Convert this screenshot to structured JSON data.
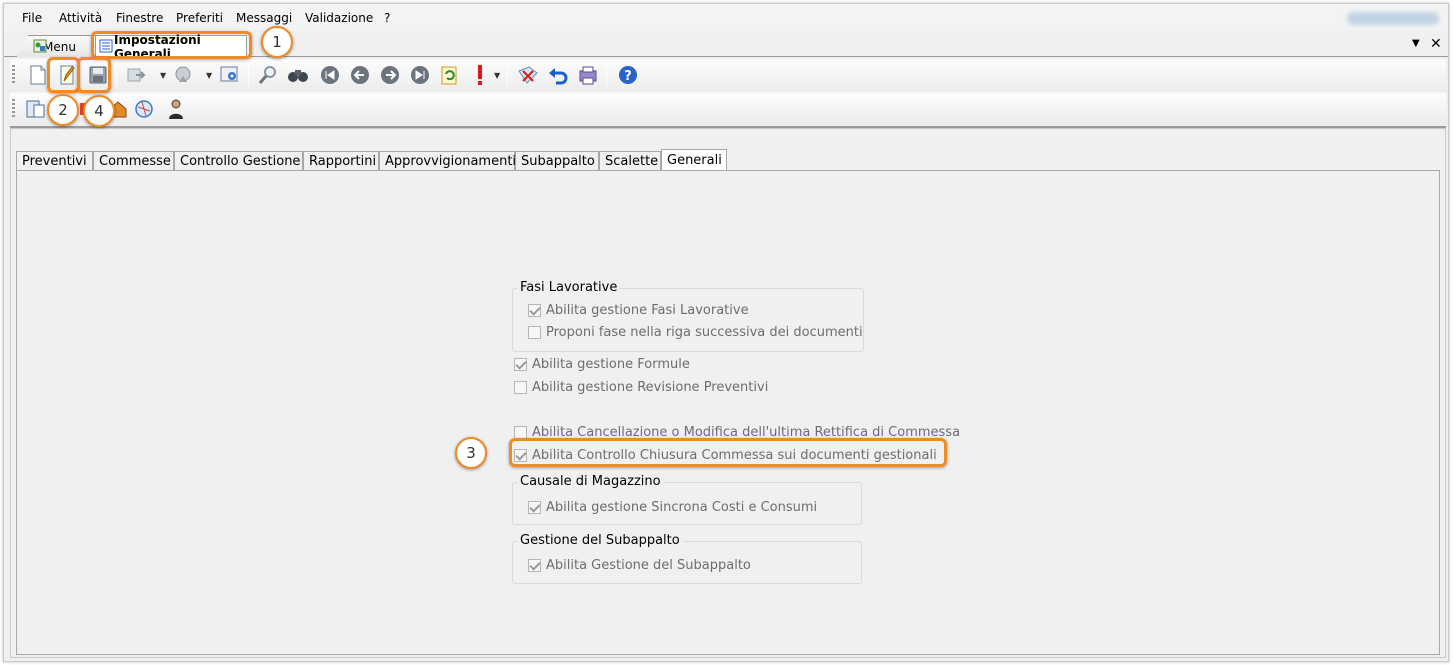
{
  "menubar": {
    "items": [
      "File",
      "Attività",
      "Finestre",
      "Preferiti",
      "Messaggi",
      "Validazione",
      "?"
    ]
  },
  "doc_tabs": {
    "menu_label": "Menu",
    "impostazioni_label": "Impostazioni Generali",
    "dropdown_glyph": "▼",
    "close_glyph": "✕"
  },
  "toolbar1": {
    "buttons": [
      "new-document-icon",
      "edit-icon",
      "save-icon",
      "export-icon",
      "satellite-icon",
      "settings-icon",
      "search-icon",
      "binoculars-icon",
      "first-record-icon",
      "previous-record-icon",
      "next-record-icon",
      "last-record-icon",
      "refresh-icon",
      "alert-icon",
      "cancel-icon",
      "undo-icon",
      "print-icon",
      "help-icon"
    ]
  },
  "toolbar2": {
    "buttons": [
      "clipboard-icon",
      "attachment-icon",
      "home-icon",
      "globe-icon",
      "user-icon"
    ]
  },
  "page_tabs": [
    "Preventivi",
    "Commesse",
    "Controllo Gestione",
    "Rapportini",
    "Approvvigionamenti",
    "Subappalto",
    "Scalette",
    "Generali"
  ],
  "form": {
    "fasi_group": {
      "title": "Fasi Lavorative",
      "abilita_fasi": {
        "label": "Abilita gestione Fasi Lavorative",
        "checked": true
      },
      "proponi_fase": {
        "label": "Proponi fase nella riga successiva dei documenti",
        "checked": false
      }
    },
    "formule": {
      "label": "Abilita gestione Formule",
      "checked": true
    },
    "revisione": {
      "label": "Abilita gestione Revisione Preventivi",
      "checked": false
    },
    "cancellazione": {
      "label": "Abilita Cancellazione o Modifica dell'ultima Rettifica di Commessa",
      "checked": false
    },
    "controllo_chiusura": {
      "label": "Abilita Controllo Chiusura Commessa sui documenti gestionali",
      "checked": true
    },
    "causale_group": {
      "title": "Causale di Magazzino",
      "sincrona": {
        "label": "Abilita gestione Sincrona Costi e Consumi",
        "checked": true
      }
    },
    "subappalto_group": {
      "title": "Gestione del Subappalto",
      "abilita_sub": {
        "label": "Abilita Gestione del Subappalto",
        "checked": true
      }
    }
  },
  "callouts": [
    "1",
    "2",
    "3",
    "4"
  ],
  "colors": {
    "accent_orange": "#f08a24",
    "tab_blue": "#2a62c9"
  }
}
